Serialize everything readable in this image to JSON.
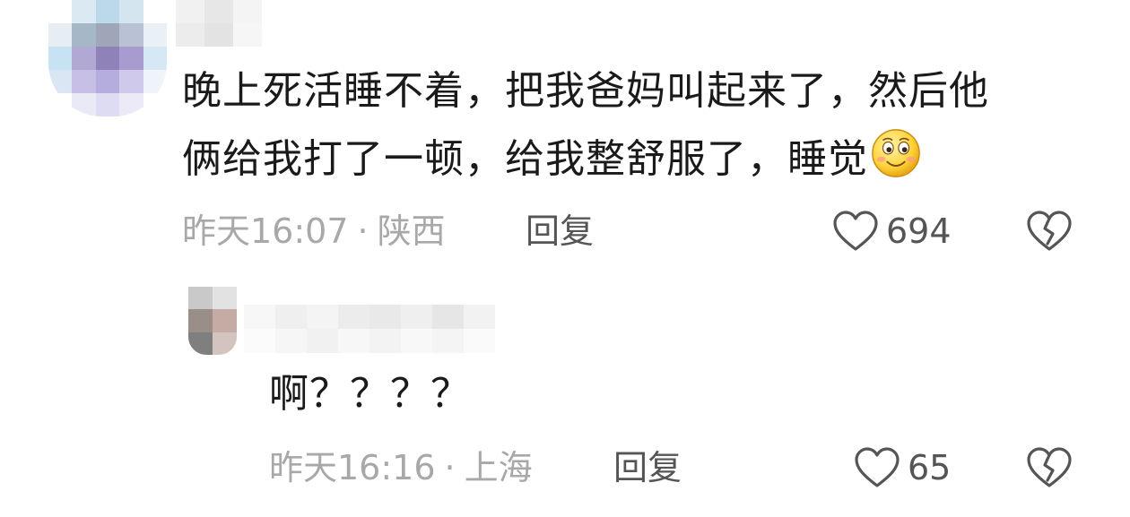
{
  "comments": [
    {
      "text_line1": "晚上死活睡不着，把我爸妈叫起来了，然后他",
      "text_line2": "俩给我打了一顿，给我整舒服了，睡觉",
      "emoji_icon": "smile-blush-emoji",
      "time": "昨天16:07",
      "location": "陕西",
      "reply_label": "回复",
      "likes": "694"
    },
    {
      "text": "啊？？？？",
      "time": "昨天16:16",
      "location": "上海",
      "reply_label": "回复",
      "likes": "65"
    }
  ],
  "separator": "·",
  "icons": {
    "like": "heart-outline-icon",
    "dislike": "broken-heart-icon"
  },
  "colors": {
    "text": "#1a1a1a",
    "meta": "#a8a8a8",
    "action": "#555555"
  }
}
